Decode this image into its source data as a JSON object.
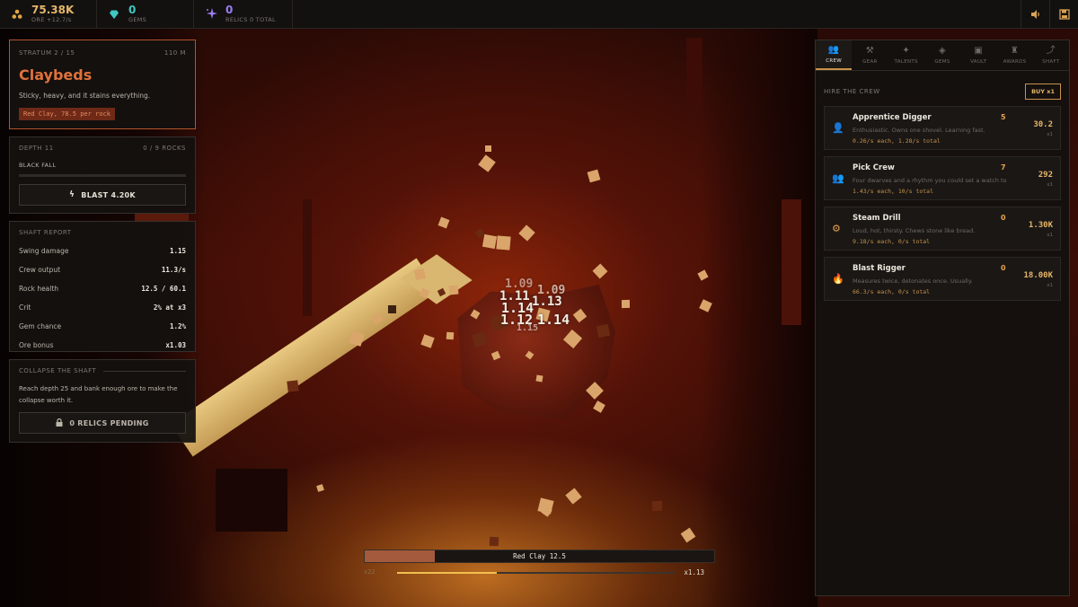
{
  "topbar": {
    "ore": {
      "value": "75.38K",
      "sub": "ORE +12.7/s",
      "icon": "ore-cluster-icon"
    },
    "gems": {
      "value": "0",
      "sub": "GEMS",
      "icon": "gem-icon"
    },
    "relics": {
      "value": "0",
      "sub": "RELICS 0 TOTAL",
      "icon": "sparkle-icon"
    },
    "actions": [
      {
        "icon": "speaker-icon"
      },
      {
        "icon": "save-icon"
      }
    ]
  },
  "stratum": {
    "label": "STRATUM 2 / 15",
    "depth_m": "110 m",
    "name": "Claybeds",
    "description": "Sticky, heavy, and it stains everything.",
    "tag": "Red Clay, 78.5 per rock"
  },
  "depth_panel": {
    "label": "DEPTH 11",
    "rocks": "0 / 9 ROCKS",
    "fall_label": "BLACK FALL",
    "progress": 0,
    "blast_label": "BLAST 4.20K"
  },
  "report": {
    "title": "SHAFT REPORT",
    "rows": [
      {
        "k": "Swing damage",
        "v": "1.15"
      },
      {
        "k": "Crew output",
        "v": "11.3/s"
      },
      {
        "k": "Rock health",
        "v": "12.5 / 60.1"
      },
      {
        "k": "Crit",
        "v": "2% at x3"
      },
      {
        "k": "Gem chance",
        "v": "1.2%"
      },
      {
        "k": "Ore bonus",
        "v": "x1.03"
      }
    ]
  },
  "collapse": {
    "title": "COLLAPSE THE SHAFT",
    "description": "Reach depth 25 and bank enough ore to make the collapse worth it.",
    "button_label": "0 RELICS PENDING"
  },
  "tabs": [
    {
      "label": "CREW",
      "icon": "crew-icon",
      "glyph": "👥",
      "active": true
    },
    {
      "label": "GEAR",
      "icon": "pickaxe-icon",
      "glyph": "⚒",
      "active": false
    },
    {
      "label": "TALENTS",
      "icon": "sparkle-icon",
      "glyph": "✦",
      "active": false
    },
    {
      "label": "GEMS",
      "icon": "gem-icon",
      "glyph": "◈",
      "active": false
    },
    {
      "label": "VAULT",
      "icon": "vault-icon",
      "glyph": "▣",
      "active": false
    },
    {
      "label": "AWARDS",
      "icon": "trophy-icon",
      "glyph": "♜",
      "active": false
    },
    {
      "label": "SHAFT",
      "icon": "chart-icon",
      "glyph": "⤴",
      "active": false
    }
  ],
  "crew": {
    "heading": "HIRE THE CREW",
    "buy_label": "BUY x1",
    "items": [
      {
        "name": "Apprentice Digger",
        "count": "5",
        "desc": "Enthusiastic. Owns one shovel. Learning fast.",
        "rate": "0.26/s each, 1.28/s total",
        "price": "30.2",
        "mult": "x1",
        "icon": "person-icon",
        "glyph": "👤"
      },
      {
        "name": "Pick Crew",
        "count": "7",
        "desc": "Four dwarves and a rhythm you could set a watch to.",
        "rate": "1.43/s each, 10/s total",
        "price": "292",
        "mult": "x1",
        "icon": "group-icon",
        "glyph": "👥"
      },
      {
        "name": "Steam Drill",
        "count": "0",
        "desc": "Loud, hot, thirsty. Chews stone like bread.",
        "rate": "9.18/s each, 0/s total",
        "price": "1.30K",
        "mult": "x1",
        "icon": "gear-icon",
        "glyph": "⚙"
      },
      {
        "name": "Blast Rigger",
        "count": "0",
        "desc": "Measures twice, detonates once. Usually.",
        "rate": "66.3/s each, 0/s total",
        "price": "18.00K",
        "mult": "x1",
        "icon": "flame-icon",
        "glyph": "🔥"
      }
    ]
  },
  "rock_hp": {
    "label": "Red Clay 12.5",
    "fraction": 0.2
  },
  "combo": {
    "left": "x22",
    "right": "x1.13",
    "fraction": 0.36
  },
  "damage_numbers": [
    "1.09",
    "1.11",
    "1.09",
    "1.14",
    "1.13",
    "1.12",
    "1.14",
    "1.15"
  ],
  "colors": {
    "accent": "#e0713b",
    "gold": "#e6b56a",
    "gem": "#3fc7c0",
    "relic": "#9b7cf0"
  }
}
